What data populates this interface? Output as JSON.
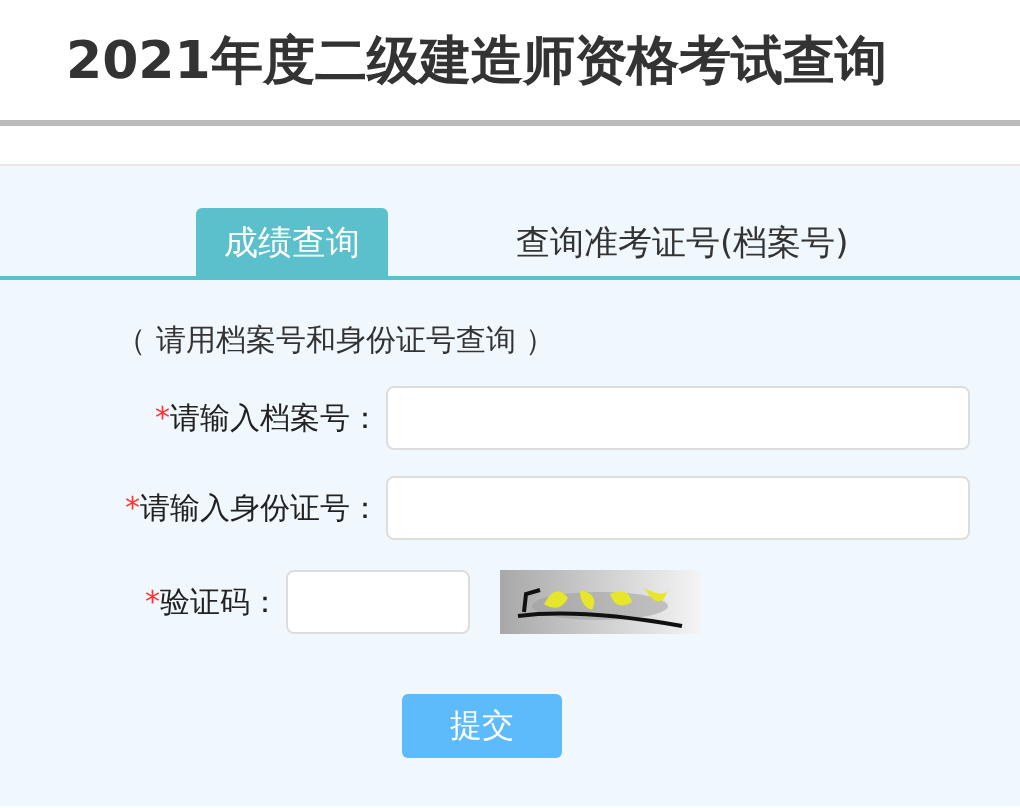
{
  "title": "2021年度二级建造师资格考试查询",
  "tabs": [
    {
      "label": "成绩查询",
      "selected": true
    },
    {
      "label": "查询准考证号(档案号)",
      "selected": false
    }
  ],
  "note": "（ 请用档案号和身份证号查询 ）",
  "fields": [
    {
      "kind": "text",
      "required_mark": "*",
      "label": "请输入档案号："
    },
    {
      "kind": "text",
      "required_mark": "*",
      "label": "请输入身份证号："
    },
    {
      "kind": "captcha",
      "required_mark": "*",
      "label": "验证码："
    }
  ],
  "submit": "提交"
}
